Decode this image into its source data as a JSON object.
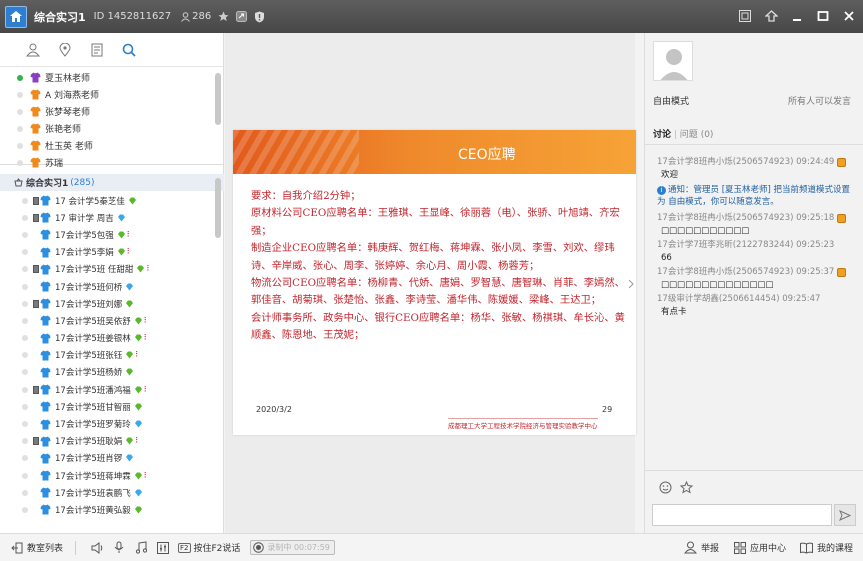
{
  "titlebar": {
    "title": "综合实习1",
    "room_id": "ID 1452811627",
    "people_count": "286"
  },
  "teachers": [
    {
      "name": "夏玉林老师",
      "online": true,
      "shirt": "purple"
    },
    {
      "name": "A 刘海燕老师",
      "online": false,
      "shirt": "orange"
    },
    {
      "name": "张梦琴老师",
      "online": false,
      "shirt": "orange"
    },
    {
      "name": "张艳老师",
      "online": false,
      "shirt": "orange"
    },
    {
      "name": "杜玉英 老师",
      "online": false,
      "shirt": "orange"
    },
    {
      "name": "苏瑞",
      "online": false,
      "shirt": "orange"
    }
  ],
  "class_group": {
    "name": "综合实习1",
    "count": "(285)"
  },
  "students": [
    {
      "name": "17 会计学5秦芝佳",
      "gem": "green",
      "mark": false,
      "sq": true
    },
    {
      "name": "17 审计学 周吉",
      "gem": "blue",
      "mark": false,
      "sq": true
    },
    {
      "name": "17会计学5包强",
      "gem": "green",
      "mark": true,
      "sq": false
    },
    {
      "name": "17会计学5李娟",
      "gem": "green",
      "mark": true,
      "sq": false
    },
    {
      "name": "17会计学5班 任甜甜",
      "gem": "green",
      "mark": true,
      "sq": true
    },
    {
      "name": "17会计学5班何桥",
      "gem": "blue",
      "mark": false,
      "sq": false
    },
    {
      "name": "17会计学5班刘娜",
      "gem": "green",
      "mark": false,
      "sq": true
    },
    {
      "name": "17会计学5班吴依舒",
      "gem": "green",
      "mark": true,
      "sq": false
    },
    {
      "name": "17会计学5班姜银林",
      "gem": "green",
      "mark": true,
      "sq": false
    },
    {
      "name": "17会计学5班张钰",
      "gem": "green",
      "mark": true,
      "sq": false
    },
    {
      "name": "17会计学5班杨娇",
      "gem": "green",
      "mark": false,
      "sq": false
    },
    {
      "name": "17会计学5班潘鸿福",
      "gem": "green",
      "mark": true,
      "sq": true
    },
    {
      "name": "17会计学5班甘智丽",
      "gem": "green",
      "mark": false,
      "sq": false
    },
    {
      "name": "17会计学5班罗菊玲",
      "gem": "blue",
      "mark": false,
      "sq": false
    },
    {
      "name": "17会计学5班耿娟",
      "gem": "green",
      "mark": true,
      "sq": true
    },
    {
      "name": "17会计学5班肖锣",
      "gem": "blue",
      "mark": false,
      "sq": false
    },
    {
      "name": "17会计学5班蒋坤霖",
      "gem": "green",
      "mark": true,
      "sq": false
    },
    {
      "name": "17会计学5班袁鹏飞",
      "gem": "blue",
      "mark": false,
      "sq": false
    },
    {
      "name": "17会计学5班黄弘毅",
      "gem": "green",
      "mark": false,
      "sq": false
    }
  ],
  "slide": {
    "title": "CEO应聘",
    "body": [
      "要求：自我介绍2分钟；",
      "原材料公司CEO应聘名单：王雅琪、王显峰、徐丽蓉（电）、张骄、叶旭靖、齐宏强；",
      "制造企业CEO应聘名单：韩庚辉、贺红梅、蒋坤霖、张小凤、李雪、刘欢、缪玮诗、辛岸威、张心、周李、张婷婷、余心月、周小霞、杨蓉芳；",
      "物流公司CEO应聘名单：杨柳青、代娇、唐娟、罗智慧、唐智琳、肖菲、李嫣然、郭佳音、胡菊琪、张楚怡、张鑫、李诗莹、潘华伟、陈媛媛、梁峰、王达卫；",
      "会计师事务所、政务中心、银行CEO应聘名单：杨华、张敏、杨祺琪、牟长沁、黄顺鑫、陈恩地、王茂妮；"
    ],
    "date": "2020/3/2",
    "page": "29",
    "footer": "成都理工大学工程技术学院经济与管理实验教学中心"
  },
  "right": {
    "mode": "自由模式",
    "mode_right": "所有人可以发言",
    "tab_discuss": "讨论",
    "tab_question": "问题",
    "question_count": "(0)",
    "messages": [
      {
        "head": "17会计学8班冉小烁(2506574923) 09:24:49",
        "body": "欢迎",
        "icon": true
      },
      {
        "notice": "通知：管理员 [夏玉林老师] 把当前频道模式设置为 自由模式，你可以随意发言。"
      },
      {
        "head": "17会计学8班冉小烁(2506574923) 09:25:18",
        "body": "□□□□□□□□□□□",
        "icon": true
      },
      {
        "head": "17会计学7班李兆昕(2122783244) 09:25:23",
        "body": "66",
        "icon": false
      },
      {
        "head": "17会计学8班冉小烁(2506574923) 09:25:37",
        "body": "□□□□□□□□□□□□□□",
        "icon": true
      },
      {
        "head": "17级审计学胡鑫(2506614454) 09:25:47",
        "body": "有点卡",
        "icon": false
      }
    ]
  },
  "bottom": {
    "room_list": "教室列表",
    "f2_key": "F2",
    "f2_label": "按住F2说话",
    "record_time": "录制中 00:07:59",
    "report": "举报",
    "app_center": "应用中心",
    "my_course": "我的课程"
  },
  "colors": {
    "titlebar": "#4f4f4f",
    "slide_red": "#c4262e",
    "banner_orange": "#ef8a2c",
    "link_blue": "#2c7fd0"
  }
}
